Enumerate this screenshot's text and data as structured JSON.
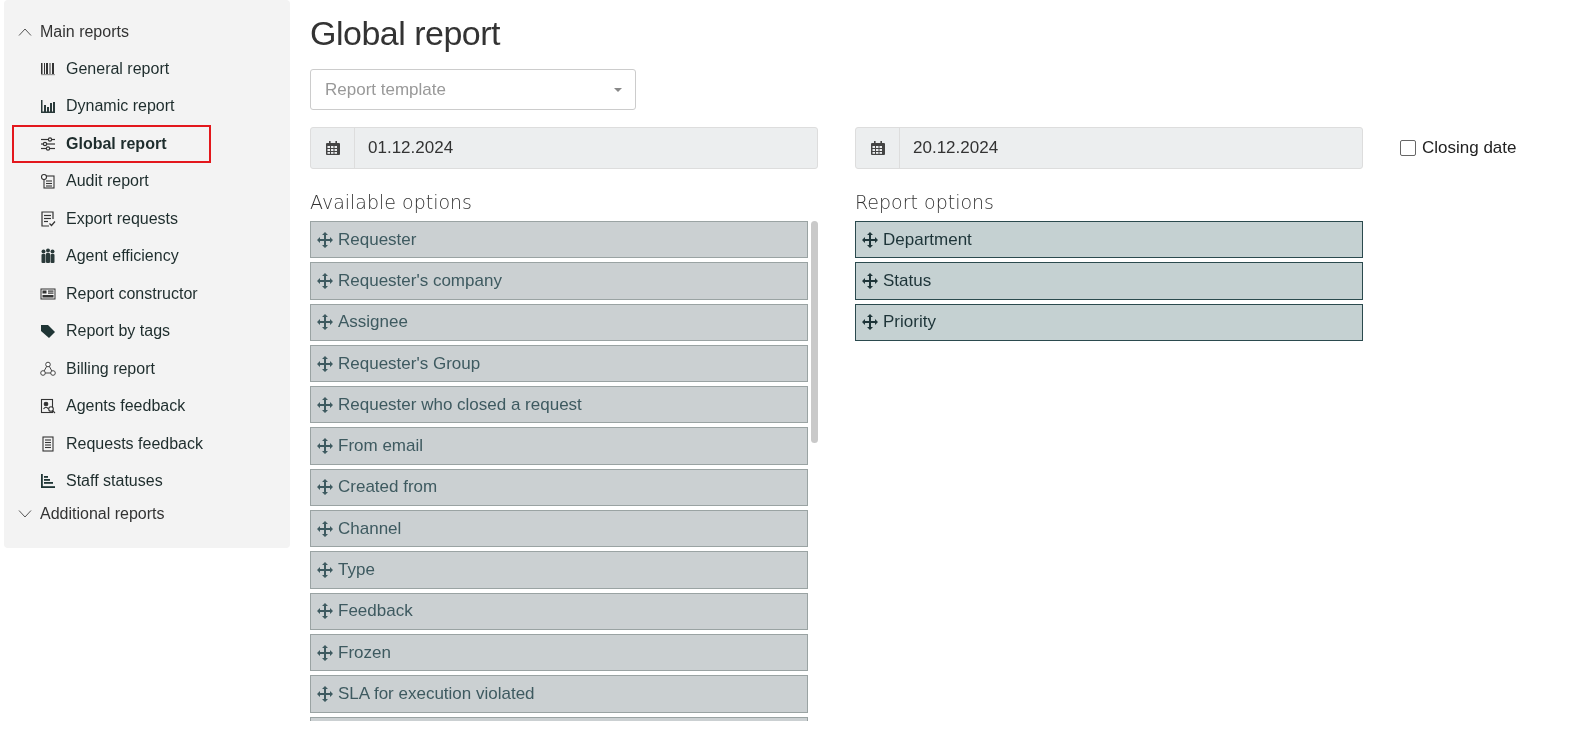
{
  "sidebar": {
    "sections": [
      {
        "label": "Main reports",
        "expanded": true,
        "children": [
          {
            "label": "General report",
            "selected": false
          },
          {
            "label": "Dynamic report",
            "selected": false
          },
          {
            "label": "Global report",
            "selected": true
          },
          {
            "label": "Audit report",
            "selected": false
          },
          {
            "label": "Export requests",
            "selected": false
          },
          {
            "label": "Agent efficiency",
            "selected": false
          },
          {
            "label": "Report constructor",
            "selected": false
          },
          {
            "label": "Report by tags",
            "selected": false
          },
          {
            "label": "Billing report",
            "selected": false
          },
          {
            "label": "Agents feedback",
            "selected": false
          },
          {
            "label": "Requests feedback",
            "selected": false
          },
          {
            "label": "Staff statuses",
            "selected": false
          }
        ]
      },
      {
        "label": "Additional reports",
        "expanded": false
      }
    ]
  },
  "page": {
    "title": "Global report",
    "template_select": {
      "placeholder": "Report template"
    },
    "date_from": {
      "value": "01.12.2024"
    },
    "date_to": {
      "value": "20.12.2024"
    },
    "closing_date": {
      "label": "Closing date",
      "checked": false
    },
    "available_options": {
      "heading": "Available options",
      "items": [
        "Requester",
        "Requester's company",
        "Assignee",
        "Requester's Group",
        "Requester who closed a request",
        "From email",
        "Created from",
        "Channel",
        "Type",
        "Feedback",
        "Frozen",
        "SLA for execution violated"
      ]
    },
    "report_options": {
      "heading": "Report options",
      "items": [
        "Department",
        "Status",
        "Priority"
      ]
    }
  }
}
